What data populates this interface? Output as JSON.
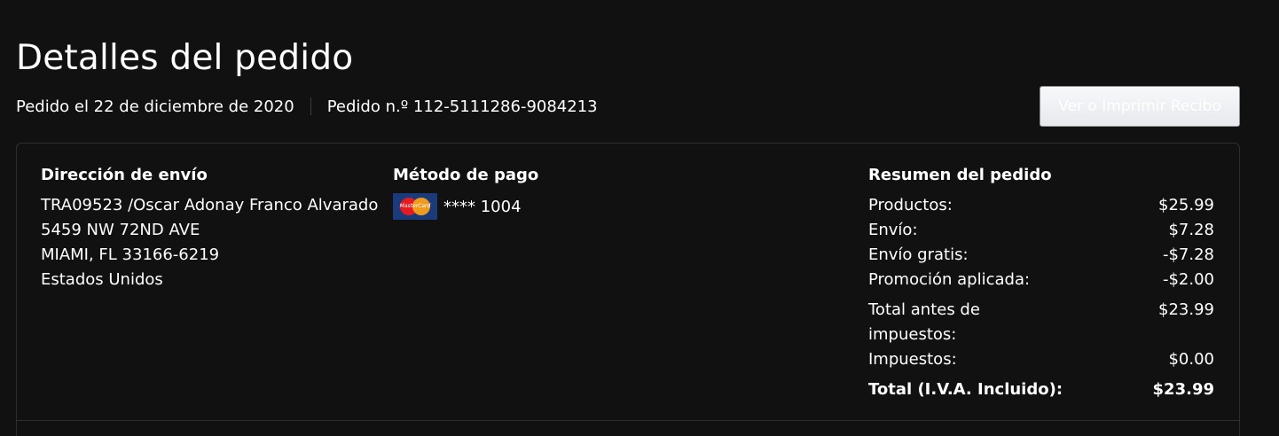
{
  "page": {
    "title": "Detalles del pedido",
    "order_date": "Pedido el 22 de diciembre de 2020",
    "order_number": "Pedido n.º 112-5111286-9084213",
    "receipt_button": "Ver o Imprimir Recibo"
  },
  "shipping": {
    "heading": "Dirección de envío",
    "lines": [
      "TRA09523 /Oscar Adonay Franco Alvarado",
      "5459 NW 72ND AVE",
      "MIAMI, FL 33166-6219",
      "Estados Unidos"
    ]
  },
  "payment": {
    "heading": "Método de pago",
    "card_icon": "mastercard-icon",
    "card_logo_text": "MasterCard",
    "card_masked": "**** 1004"
  },
  "summary": {
    "heading": "Resumen del pedido",
    "rows": [
      {
        "label": "Productos:",
        "value": "$25.99"
      },
      {
        "label": "Envío:",
        "value": "$7.28"
      },
      {
        "label": "Envío gratis:",
        "value": "-$7.28"
      },
      {
        "label": "Promoción aplicada:",
        "value": "-$2.00"
      },
      {
        "label": "Total antes de impuestos:",
        "value": "$23.99"
      },
      {
        "label": "Impuestos:",
        "value": "$0.00"
      }
    ],
    "total": {
      "label": "Total (I.V.A. Incluido):",
      "value": "$23.99"
    }
  },
  "colors": {
    "background": "#111111",
    "text": "#ffffff",
    "border": "#2e2e2e",
    "button_gradient_top": "#f7f8fa",
    "button_gradient_bottom": "#e7e9ec"
  }
}
